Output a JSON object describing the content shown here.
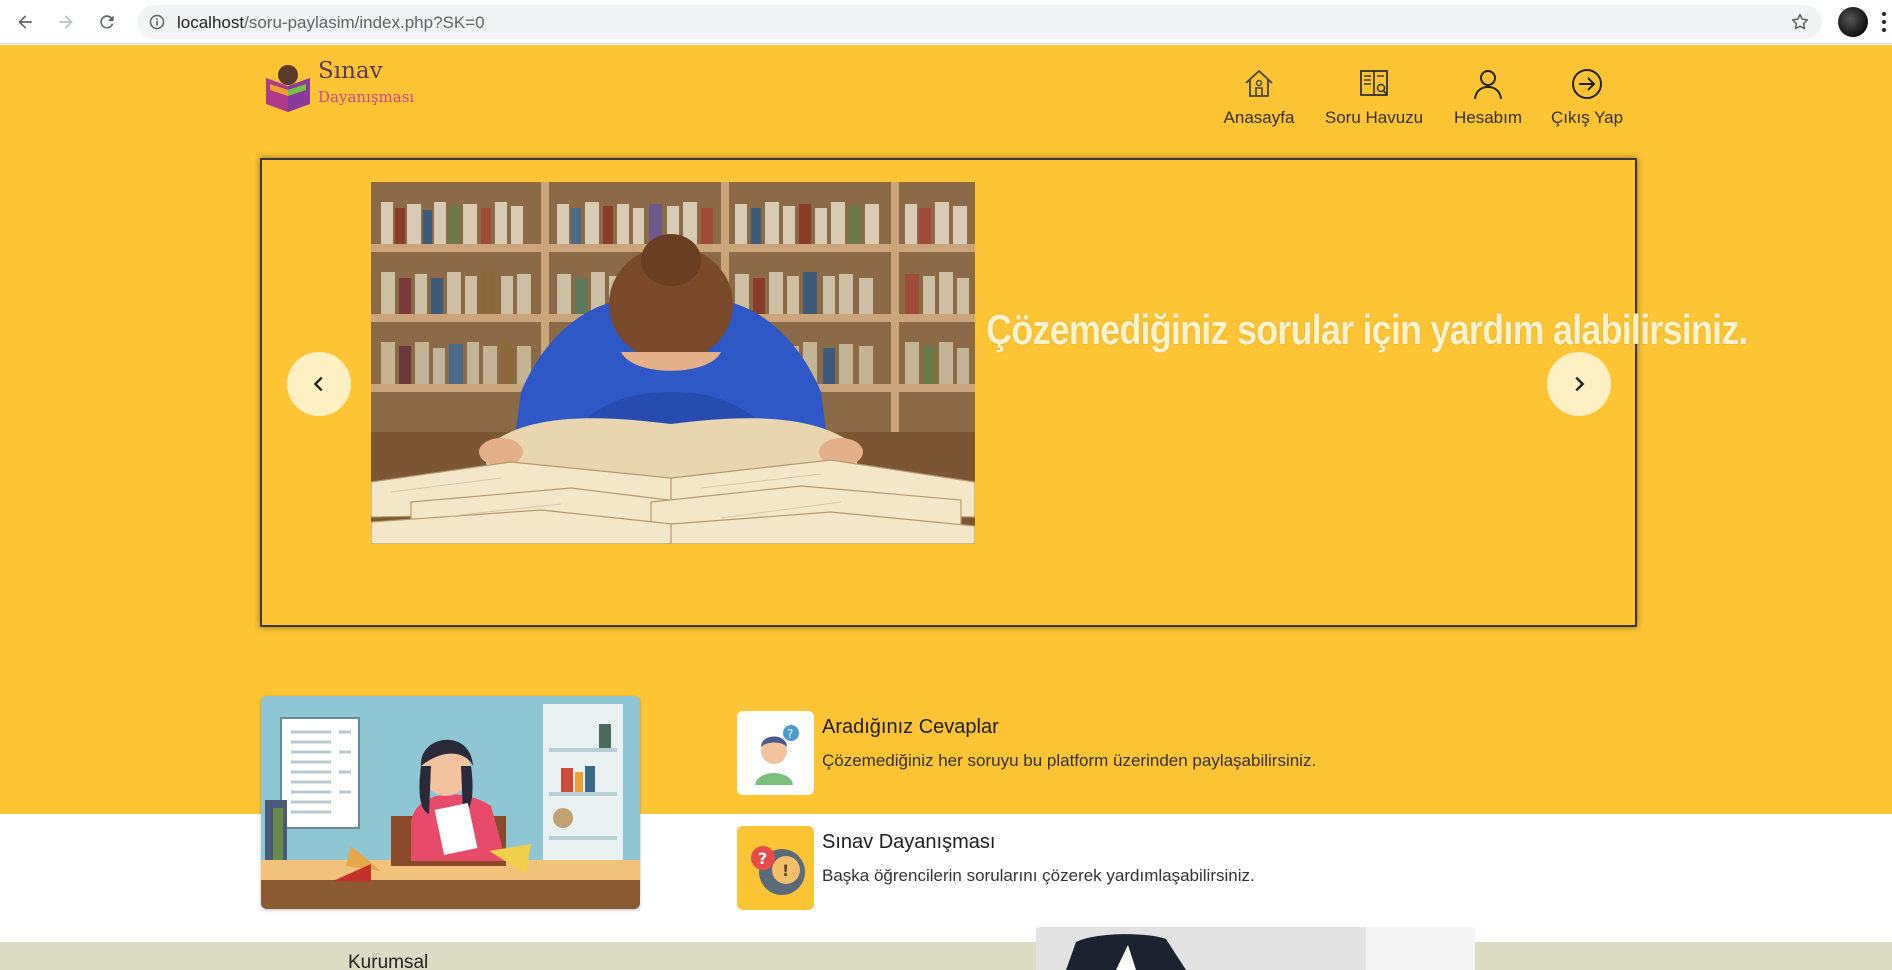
{
  "browser": {
    "url_host": "localhost",
    "url_path": "/soru-paylasim/index.php?SK=0"
  },
  "logo": {
    "line1": "Sınav",
    "line2": "Dayanışması"
  },
  "nav": [
    {
      "label": "Anasayfa",
      "icon": "home-icon"
    },
    {
      "label": "Soru Havuzu",
      "icon": "book-icon"
    },
    {
      "label": "Hesabım",
      "icon": "user-icon"
    },
    {
      "label": "Çıkış Yap",
      "icon": "logout-icon"
    }
  ],
  "slider": {
    "caption": "Çözemediğiniz sorular için yardım alabilirsiniz."
  },
  "features": [
    {
      "title": "Aradığınız Cevaplar",
      "desc": "Çözemediğiniz her soruyu bu platform üzerinden paylaşabilirsiniz.",
      "icon": "question-person-icon"
    },
    {
      "title": "Sınav Dayanışması",
      "desc": "Başka öğrencilerin sorularını çözerek yardımlaşabilirsiniz.",
      "icon": "question-bubble-icon"
    }
  ],
  "footer": {
    "title": "Kurumsal"
  },
  "colors": {
    "primary_yellow": "#fec433",
    "footer_band": "#dcdcc2",
    "logo_pink": "#d04a8a"
  }
}
